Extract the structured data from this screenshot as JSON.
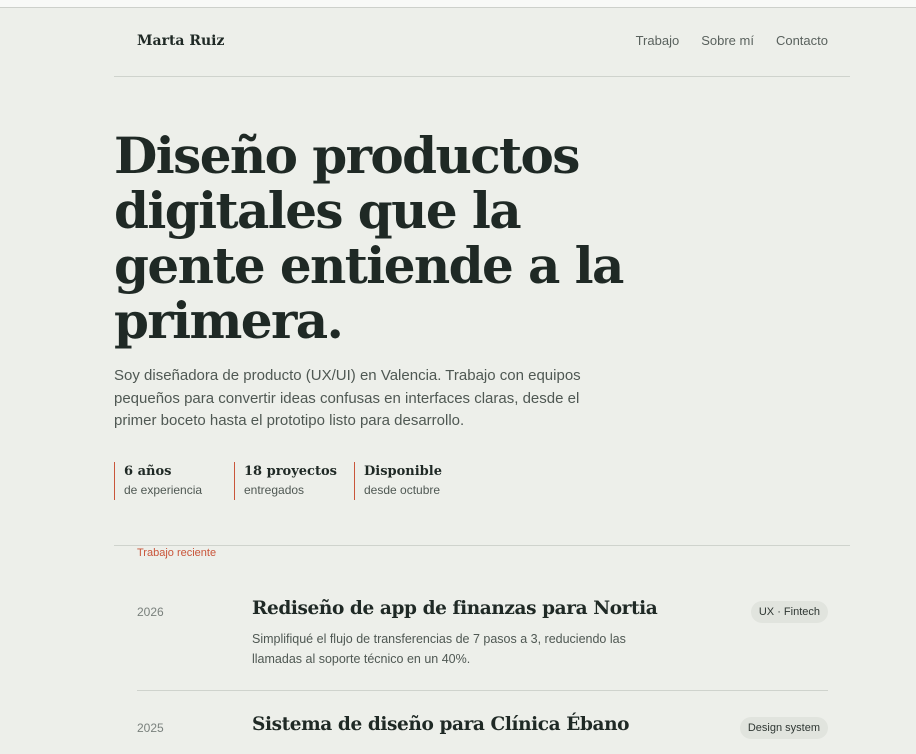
{
  "header": {
    "brand": "Marta Ruiz",
    "nav": [
      "Trabajo",
      "Sobre mí",
      "Contacto"
    ]
  },
  "hero": {
    "title": "Diseño productos digitales que la gente entiende a la primera.",
    "subtitle": "Soy diseñadora de producto (UX/UI) en Valencia. Trabajo con equipos pequeños para convertir ideas confusas en interfaces claras, desde el primer boceto hasta el prototipo listo para desarrollo."
  },
  "stats": [
    {
      "value": "6 años",
      "label": "de experiencia"
    },
    {
      "value": "18 proyectos",
      "label": "entregados"
    },
    {
      "value": "Disponible",
      "label": "desde octubre"
    }
  ],
  "recent": {
    "label": "Trabajo reciente",
    "projects": [
      {
        "year": "2026",
        "title": "Rediseño de app de finanzas para Nortia",
        "description": "Simplifiqué el flujo de transferencias de 7 pasos a 3, reduciendo las llamadas al soporte técnico en un 40%.",
        "tag": "UX · Fintech"
      },
      {
        "year": "2025",
        "title": "Sistema de diseño para Clínica Ébano",
        "tag": "Design system"
      }
    ]
  },
  "colors": {
    "background": "#edefea",
    "accent": "#c9553a",
    "text": "#1f2925"
  }
}
